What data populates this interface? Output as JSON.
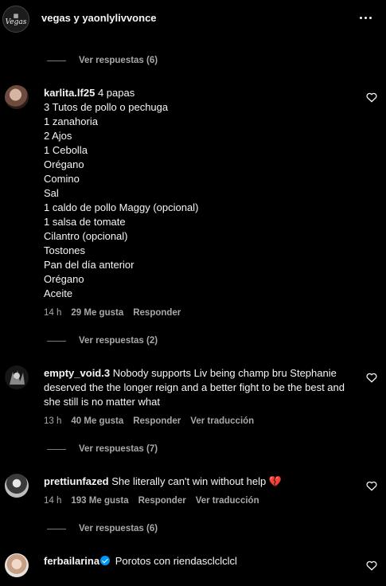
{
  "header": {
    "avatar_text": "Vegas",
    "title": "vegas y yaonlylivvonce"
  },
  "replies": [
    {
      "label": "Ver respuestas (6)"
    },
    {
      "label": "Ver respuestas (2)"
    },
    {
      "label": "Ver respuestas (7)"
    },
    {
      "label": "Ver respuestas (6)"
    }
  ],
  "comments": [
    {
      "username": "karlita.lf25",
      "lines": [
        "4 papas",
        "3 Tutos de pollo o pechuga",
        "1 zanahoria",
        "2 Ajos",
        "1 Cebolla",
        "Orégano",
        "Comino",
        "Sal",
        "1 caldo de pollo Maggy (opcional)",
        "1 salsa de tomate",
        "Cilantro (opcional)",
        "Tostones",
        "Pan del día anterior",
        "Orégano",
        "Aceite"
      ],
      "time": "14 h",
      "likes": "29 Me gusta",
      "reply": "Responder"
    },
    {
      "username": "empty_void.3",
      "text": "Nobody supports Liv being champ bru Stephanie deserved the the longer reign and a better fight to be the best and she still is no matter what",
      "time": "13 h",
      "likes": "40 Me gusta",
      "reply": "Responder",
      "translate": "Ver traducción"
    },
    {
      "username": "prettiunfazed",
      "text": "She literally can't win without help",
      "emoji": "💔",
      "time": "14 h",
      "likes": "193 Me gusta",
      "reply": "Responder",
      "translate": "Ver traducción"
    },
    {
      "username": "ferbailarina",
      "text": "Porotos con riendasclclclcl"
    }
  ],
  "colors": {
    "background": "#000000",
    "text": "#f5f5f5",
    "muted": "#a8a8a8",
    "verified": "#0095f6"
  }
}
